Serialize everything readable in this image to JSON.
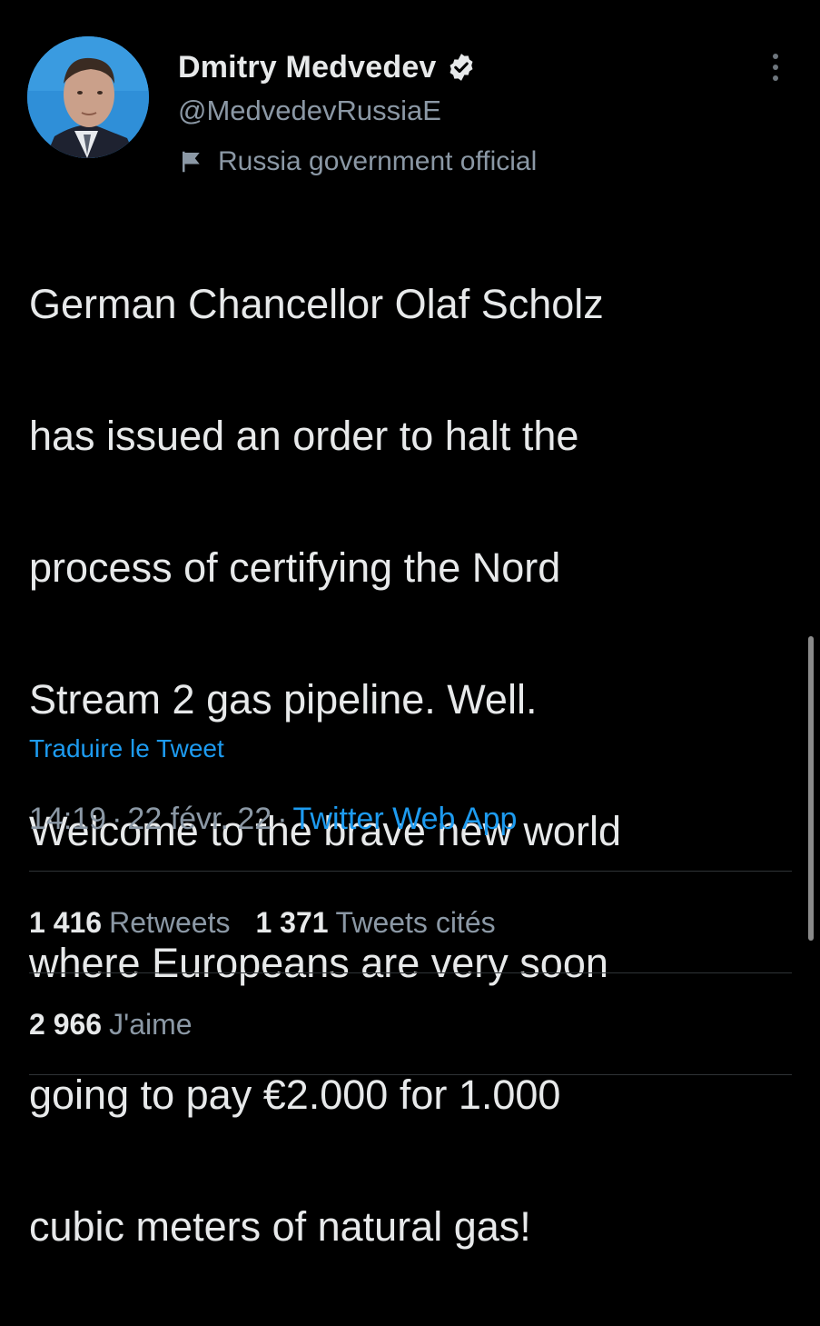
{
  "user": {
    "name": "Dmitry Medvedev",
    "handle": "@MedvedevRussiaE",
    "label": "Russia government official"
  },
  "tweet": {
    "lines": [
      "German Chancellor Olaf Scholz",
      "has issued an order to halt the",
      "process of certifying the Nord",
      "Stream 2 gas pipeline. Well.",
      "Welcome to the brave new world",
      "where Europeans are very soon",
      "going to pay €2.000 for 1.000",
      "cubic meters of natural gas!"
    ],
    "translate_label": "Traduire le Tweet",
    "time": "14:19",
    "separator": "·",
    "date": "22 févr. 22",
    "source": "Twitter Web App"
  },
  "stats": {
    "retweets_count": "1 416",
    "retweets_label": "Retweets",
    "quotes_count": "1 371",
    "quotes_label": "Tweets cités",
    "likes_count": "2 966",
    "likes_label": "J'aime"
  },
  "icons": {
    "verified": "verified-badge-icon",
    "label_flag": "flag-icon",
    "more": "more-vertical-icon"
  },
  "colors": {
    "background": "#000000",
    "text": "#e7e9ea",
    "secondary": "#8b98a5",
    "accent": "#1d9bf0",
    "divider": "#2f3336"
  }
}
